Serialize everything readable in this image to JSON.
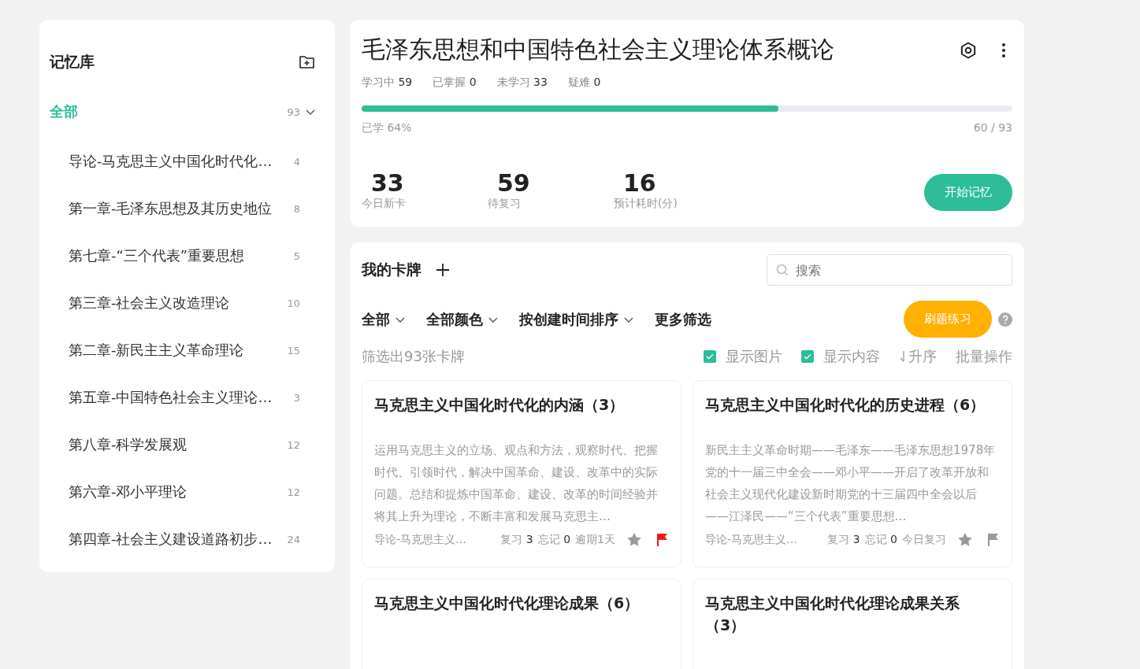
{
  "sidebar": {
    "title": "记忆库",
    "all": {
      "label": "全部",
      "count": "93",
      "selected": true,
      "expanded": true
    },
    "items": [
      {
        "label": "导论-马克思主义中国化时代化…",
        "count": "4"
      },
      {
        "label": "第一章-毛泽东思想及其历史地位",
        "count": "8"
      },
      {
        "label": "第七章-“三个代表”重要思想",
        "count": "5"
      },
      {
        "label": "第三章-社会主义改造理论",
        "count": "10"
      },
      {
        "label": "第二章-新民主主义革命理论",
        "count": "15"
      },
      {
        "label": "第五章-中国特色社会主义理论…",
        "count": "3"
      },
      {
        "label": "第八章-科学发展观",
        "count": "12"
      },
      {
        "label": "第六章-邓小平理论",
        "count": "12"
      },
      {
        "label": "第四章-社会主义建设道路初步…",
        "count": "24"
      }
    ]
  },
  "deck": {
    "title": "毛泽东思想和中国特色社会主义理论体系概论",
    "stats": [
      {
        "label": "学习中",
        "value": "59"
      },
      {
        "label": "已掌握",
        "value": "0"
      },
      {
        "label": "未学习",
        "value": "33"
      },
      {
        "label": "疑难",
        "value": "0"
      }
    ],
    "progress": {
      "label": "已学 64%",
      "level": 0.64,
      "count": "60 / 93"
    },
    "summary": [
      {
        "value": "33",
        "label": "今日新卡"
      },
      {
        "value": "59",
        "label": "待复习"
      },
      {
        "value": "16",
        "label": "预计耗时(分)"
      }
    ],
    "start_button": "开始记忆"
  },
  "cards_panel": {
    "title": "我的卡牌",
    "search": {
      "placeholder": "搜索"
    },
    "filters": [
      {
        "label": "全部",
        "dropdown": true
      },
      {
        "label": "全部颜色",
        "dropdown": true
      },
      {
        "label": "按创建时间排序",
        "dropdown": true
      },
      {
        "label": "更多筛选",
        "dropdown": false
      }
    ],
    "practice_button": "刷题练习",
    "result": "筛选出93张卡牌",
    "options": [
      {
        "label": "显示图片",
        "checked": true
      },
      {
        "label": "显示内容",
        "checked": true
      }
    ],
    "sort": "升序",
    "batch": "批量操作",
    "cards": [
      {
        "title": "马克思主义中国化时代化的内涵（3）",
        "body": "运用马克思主义的立场、观点和方法，观察时代、把握时代、引领时代，解决中国革命、建设、改革中的实际问题。总结和提炼中国革命、建设、改革的时间经验并将其上升为理论，不断丰富和发展马克思主…",
        "deck": "导论-马克思主义…",
        "review_label": "复习",
        "review": "3",
        "forget_label": "忘记",
        "forget": "0",
        "due": "逾期1天",
        "starred": false,
        "flagged": true
      },
      {
        "title": "马克思主义中国化时代化的历史进程（6）",
        "body": "新民主主义革命时期——毛泽东——毛泽东思想1978年党的十一届三中全会——邓小平——开启了改革开放和社会主义现代化建设新时期党的十三届四中全会以后——江泽民——“三个代表”重要思想…",
        "deck": "导论-马克思主义…",
        "review_label": "复习",
        "review": "3",
        "forget_label": "忘记",
        "forget": "0",
        "due": "今日复习",
        "starred": false,
        "flagged": false
      },
      {
        "title": "马克思主义中国化时代化理论成果（6）"
      },
      {
        "title": "马克思主义中国化时代化理论成果关系（3）"
      }
    ]
  }
}
